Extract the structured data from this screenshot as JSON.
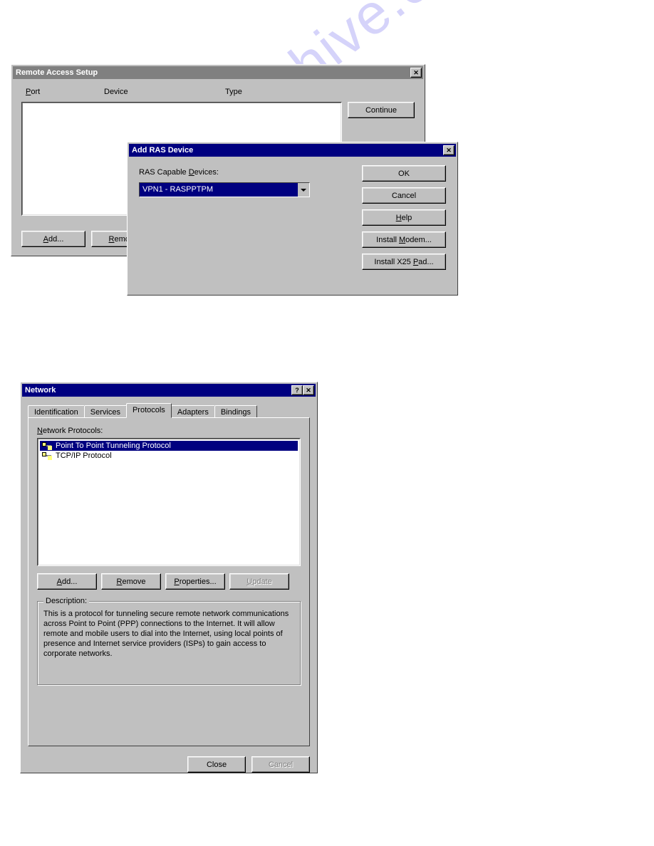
{
  "watermark": "manualshive.com",
  "ras_setup": {
    "title": "Remote Access Setup",
    "columns": {
      "port": "Port",
      "device": "Device",
      "type": "Type"
    },
    "buttons": {
      "continue": "Continue",
      "add": "Add...",
      "remove": "Remove"
    }
  },
  "add_ras": {
    "title": "Add RAS Device",
    "label_devices": "RAS Capable Devices:",
    "selected_device": "VPN1 - RASPPTPM",
    "buttons": {
      "ok": "OK",
      "cancel": "Cancel",
      "help": "Help",
      "install_modem": "Install Modem...",
      "install_x25": "Install X25 Pad..."
    }
  },
  "network": {
    "title": "Network",
    "tabs": {
      "identification": "Identification",
      "services": "Services",
      "protocols": "Protocols",
      "adapters": "Adapters",
      "bindings": "Bindings"
    },
    "label_protocols": "Network Protocols:",
    "protocols": [
      "Point To Point Tunneling Protocol",
      "TCP/IP Protocol"
    ],
    "buttons": {
      "add": "Add...",
      "remove": "Remove",
      "properties": "Properties...",
      "update": "Update"
    },
    "description_label": "Description:",
    "description_text": "This is a protocol for tunneling secure remote network communications across Point to Point (PPP) connections to the Internet. It will allow remote and mobile users to dial into the Internet, using local points of presence and Internet service providers (ISPs) to gain access to corporate networks.",
    "footer": {
      "close": "Close",
      "cancel": "Cancel"
    }
  }
}
